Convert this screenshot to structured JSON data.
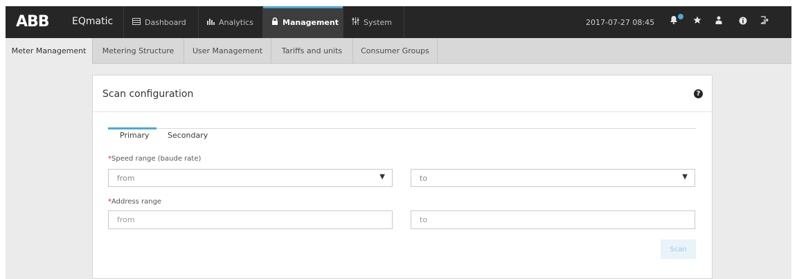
{
  "brand": {
    "logo": "ABB",
    "app_name": "EQmatic"
  },
  "nav": {
    "tabs": [
      {
        "label": "Dashboard",
        "icon": "dashboard-icon"
      },
      {
        "label": "Analytics",
        "icon": "bar-chart-icon"
      },
      {
        "label": "Management",
        "icon": "lock-icon",
        "active": true
      },
      {
        "label": "System",
        "icon": "sliders-icon"
      }
    ],
    "datetime": "2017-07-27 08:45",
    "icons": [
      "notifications-icon",
      "favorites-star-icon",
      "user-icon",
      "info-icon",
      "logout-icon"
    ]
  },
  "subnav": {
    "tabs": [
      {
        "label": "Meter Management",
        "active": true
      },
      {
        "label": "Metering Structure"
      },
      {
        "label": "User Management"
      },
      {
        "label": "Tariffs and units"
      },
      {
        "label": "Consumer Groups"
      }
    ]
  },
  "card": {
    "title": "Scan configuration",
    "tabs": {
      "primary": "Primary",
      "secondary": "Secondary"
    },
    "speed_range": {
      "label": "Speed range (baude rate)",
      "required_mark": "*",
      "from": "from",
      "to": "to"
    },
    "address_range": {
      "label": "Address range",
      "required_mark": "*",
      "from_placeholder": "from",
      "to_placeholder": "to"
    },
    "scan_button": "Scan"
  },
  "colors": {
    "topbar": "#262626",
    "accent": "#4ba8d5",
    "required": "#e02020"
  }
}
